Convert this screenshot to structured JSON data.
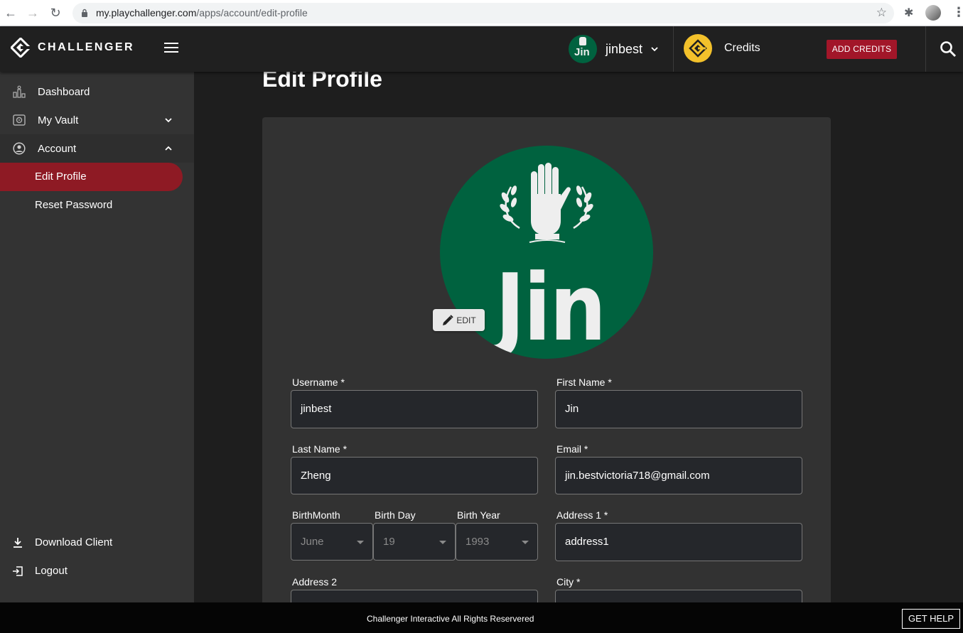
{
  "browser": {
    "url_host": "my.playchallenger.com",
    "url_path": "/apps/account/edit-profile"
  },
  "header": {
    "brand": "CHALLENGER",
    "username": "jinbest",
    "avatar_text": "Jin",
    "credits_label": "Credits",
    "add_credits": "ADD CREDITS"
  },
  "sidebar": {
    "items": [
      {
        "label": "Dashboard",
        "icon": "dashboard-icon"
      },
      {
        "label": "My Vault",
        "icon": "vault-icon"
      },
      {
        "label": "Account",
        "icon": "account-icon"
      }
    ],
    "account_sub": [
      {
        "label": "Edit Profile",
        "active": true
      },
      {
        "label": "Reset Password",
        "active": false
      }
    ],
    "bottom": [
      {
        "label": "Download Client",
        "icon": "download-icon"
      },
      {
        "label": "Logout",
        "icon": "logout-icon"
      }
    ]
  },
  "main": {
    "title": "Edit Profile",
    "avatar_text": "Jin",
    "edit_button": "EDIT",
    "form": {
      "username": {
        "label": "Username *",
        "value": "jinbest"
      },
      "first_name": {
        "label": "First Name *",
        "value": "Jin"
      },
      "last_name": {
        "label": "Last Name *",
        "value": "Zheng"
      },
      "email": {
        "label": "Email *",
        "value": "jin.bestvictoria718@gmail.com"
      },
      "birth_month": {
        "label": "BirthMonth",
        "value": "June"
      },
      "birth_day": {
        "label": "Birth Day",
        "value": "19"
      },
      "birth_year": {
        "label": "Birth Year",
        "value": "1993"
      },
      "address1": {
        "label": "Address 1 *",
        "value": "address1"
      },
      "address2": {
        "label": "Address 2",
        "value": ""
      },
      "city": {
        "label": "City *",
        "value": ""
      }
    }
  },
  "footer": {
    "copyright": "Challenger Interactive All Rights Reservered",
    "help": "GET HELP"
  },
  "colors": {
    "accent_red": "#a21629",
    "active_nav": "#8e1a24",
    "avatar_green": "#00623f",
    "coin_yellow": "#f3c12b"
  }
}
